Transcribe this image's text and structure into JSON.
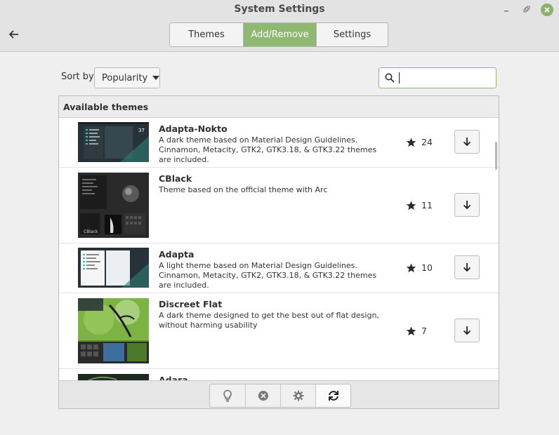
{
  "window": {
    "title": "System Settings"
  },
  "tabs": [
    {
      "label": "Themes"
    },
    {
      "label": "Add/Remove"
    },
    {
      "label": "Settings"
    }
  ],
  "sort": {
    "label": "Sort by",
    "value": "Popularity"
  },
  "search": {
    "value": "",
    "placeholder": ""
  },
  "panel": {
    "heading": "Available themes"
  },
  "themes": [
    {
      "name": "Adapta-Nokto",
      "description": "A dark theme based on Material Design Guidelines. Cinnamon, Metacity, GTK2, GTK3.18, & GTK3.22 themes are included.",
      "score": "24"
    },
    {
      "name": "CBlack",
      "description": "Theme based on the official theme with Arc",
      "score": "11"
    },
    {
      "name": "Adapta",
      "description": "A light theme based on Material Design Guidelines. Cinnamon, Metacity, GTK2, GTK3.18, & GTK3.22 themes are included.",
      "score": "10"
    },
    {
      "name": "Discreet Flat",
      "description": "A dark theme designed to get the best out of flat design, without harming usability",
      "score": "7"
    },
    {
      "name": "Adara",
      "description": "",
      "score": ""
    }
  ],
  "toolbar": {
    "icons": [
      "lightbulb-icon",
      "remove-icon",
      "gear-icon",
      "refresh-icon"
    ]
  },
  "colors": {
    "accent": "#8fb871",
    "close_button": "#8cb26a"
  }
}
